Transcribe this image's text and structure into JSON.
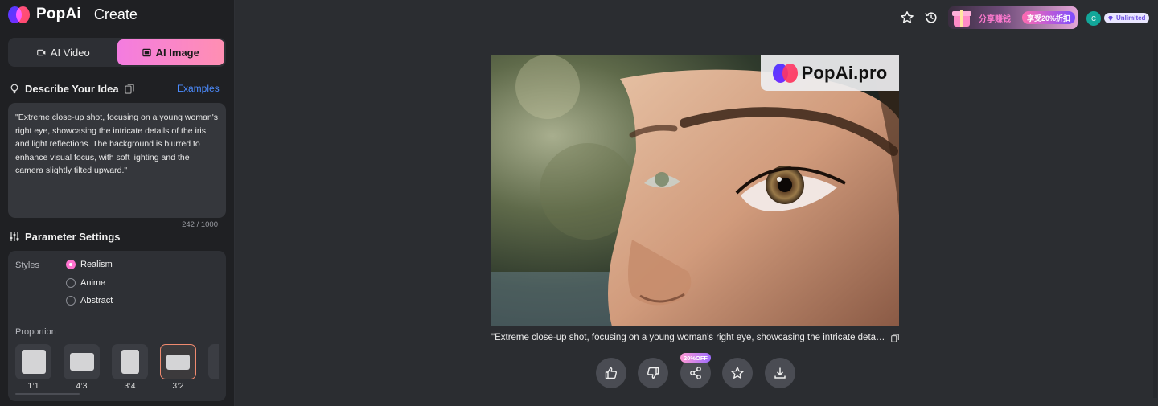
{
  "brand": {
    "name": "PopAi",
    "section": "Create"
  },
  "mode_tabs": [
    {
      "label": "AI Video",
      "active": false
    },
    {
      "label": "AI Image",
      "active": true
    }
  ],
  "describe": {
    "title": "Describe Your Idea",
    "examples_label": "Examples",
    "prompt": "\"Extreme close-up shot, focusing on a young woman's right eye, showcasing the intricate details of the iris and light reflections. The background is blurred to enhance visual focus, with soft lighting and the camera slightly tilted upward.\"",
    "char_count": "242 / 1000"
  },
  "params": {
    "title": "Parameter Settings",
    "styles_label": "Styles",
    "styles": [
      {
        "label": "Realism",
        "checked": true
      },
      {
        "label": "Anime",
        "checked": false
      },
      {
        "label": "Abstract",
        "checked": false
      }
    ],
    "proportion_label": "Proportion",
    "proportions": [
      {
        "label": "1:1",
        "selected": false
      },
      {
        "label": "4:3",
        "selected": false
      },
      {
        "label": "3:4",
        "selected": false
      },
      {
        "label": "3:2",
        "selected": true
      }
    ]
  },
  "header": {
    "promo_text": "分享赚钱",
    "promo_badge": "享受20%折扣",
    "avatar_initial": "C",
    "plan_label": "Unlimited"
  },
  "result": {
    "watermark": "PopAi.pro",
    "caption": "\"Extreme close-up shot, focusing on a young woman's right eye, showcasing the intricate details of the iris and light reflections. The background is blurred to enhance visual focus, with soft lighting and the camera slightly tilted upward.\"",
    "share_badge": "20%OFF"
  },
  "colors": {
    "accent_pink": "#ff72cf",
    "link_blue": "#4c8cff",
    "sidebar_bg": "#1f2023",
    "main_bg": "#2b2d31"
  }
}
